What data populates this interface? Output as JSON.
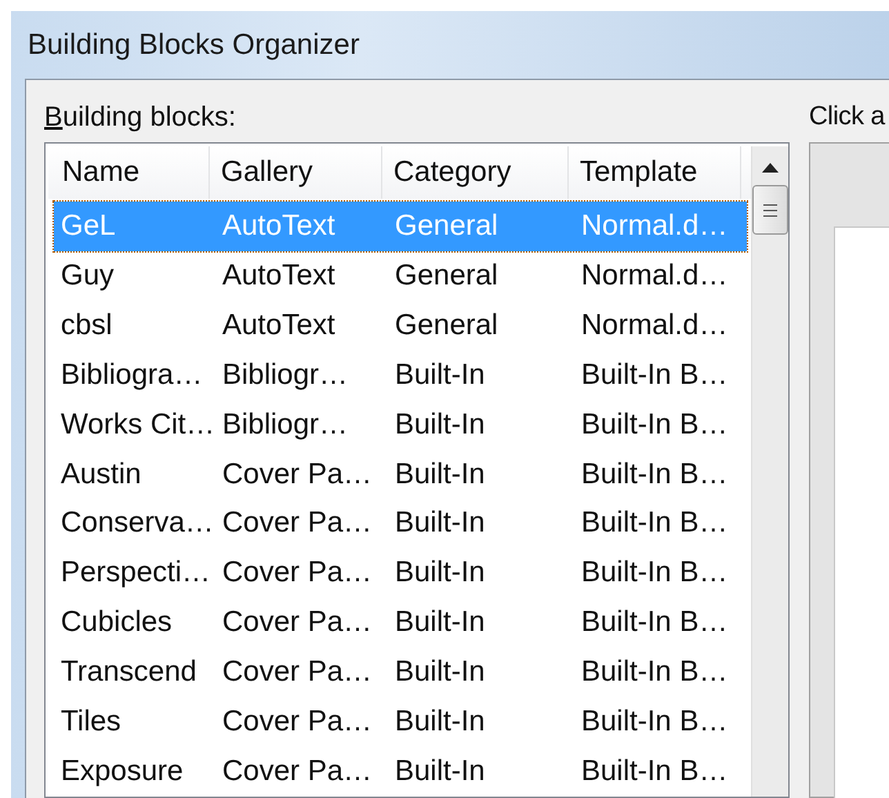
{
  "window": {
    "title": "Building Blocks Organizer"
  },
  "list": {
    "label": "Building blocks:",
    "columns": [
      "Name",
      "Gallery",
      "Category",
      "Template"
    ],
    "rows": [
      {
        "cells": [
          "GeL",
          "AutoText",
          "General",
          "Normal.d…"
        ],
        "selected": true
      },
      {
        "cells": [
          "Guy",
          "AutoText",
          "General",
          "Normal.d…"
        ],
        "selected": false
      },
      {
        "cells": [
          "cbsl",
          "AutoText",
          "General",
          "Normal.d…"
        ],
        "selected": false
      },
      {
        "cells": [
          "Bibliogra…",
          "Bibliogr…",
          "Built-In",
          "Built-In B…"
        ],
        "selected": false
      },
      {
        "cells": [
          "Works Cit…",
          "Bibliogr…",
          "Built-In",
          "Built-In B…"
        ],
        "selected": false
      },
      {
        "cells": [
          "Austin",
          "Cover Pa…",
          "Built-In",
          "Built-In B…"
        ],
        "selected": false
      },
      {
        "cells": [
          "Conserva…",
          "Cover Pa…",
          "Built-In",
          "Built-In B…"
        ],
        "selected": false
      },
      {
        "cells": [
          "Perspecti…",
          "Cover Pa…",
          "Built-In",
          "Built-In B…"
        ],
        "selected": false
      },
      {
        "cells": [
          "Cubicles",
          "Cover Pa…",
          "Built-In",
          "Built-In B…"
        ],
        "selected": false
      },
      {
        "cells": [
          "Transcend",
          "Cover Pa…",
          "Built-In",
          "Built-In B…"
        ],
        "selected": false
      },
      {
        "cells": [
          "Tiles",
          "Cover Pa…",
          "Built-In",
          "Built-In B…"
        ],
        "selected": false
      },
      {
        "cells": [
          "Exposure",
          "Cover Pa…",
          "Built-In",
          "Built-In B…"
        ],
        "selected": false
      }
    ]
  },
  "preview": {
    "label": "Click a"
  }
}
